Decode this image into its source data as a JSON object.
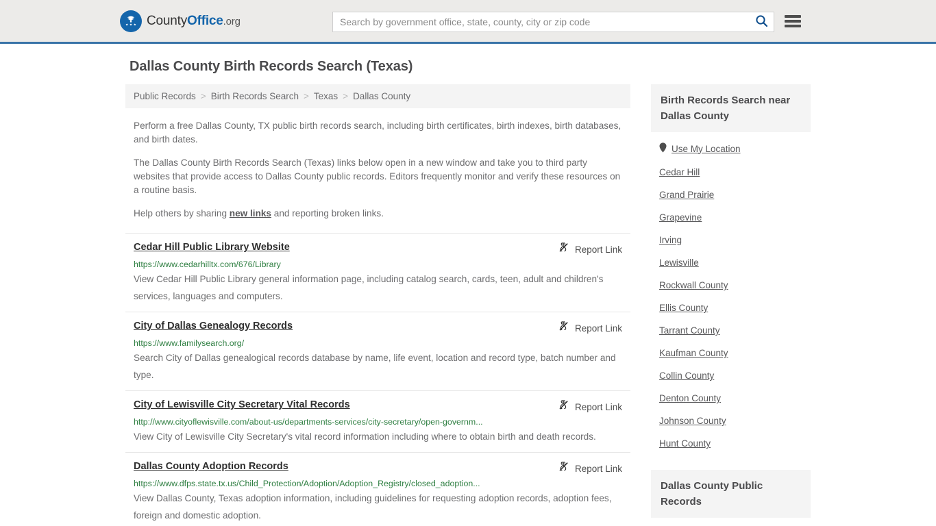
{
  "header": {
    "logo": {
      "icon": "eagle-seal-icon",
      "text_part1": "County",
      "text_part2": "Office",
      "text_part3": ".org"
    },
    "search": {
      "placeholder": "Search by government office, state, county, city or zip code",
      "value": "",
      "search_icon": "search-icon"
    },
    "menu_icon": "hamburger-menu-icon",
    "accent_color": "#3a74a8",
    "background_color": "#ecebe9"
  },
  "main": {
    "title": "Dallas County Birth Records Search (Texas)",
    "breadcrumb": [
      "Public Records",
      "Birth Records Search",
      "Texas",
      "Dallas County"
    ],
    "breadcrumb_separator": ">",
    "intro": {
      "p1": "Perform a free Dallas County, TX public birth records search, including birth certificates, birth indexes, birth databases, and birth dates.",
      "p2": "The Dallas County Birth Records Search (Texas) links below open in a new window and take you to third party websites that provide access to Dallas County public records. Editors frequently monitor and verify these resources on a routine basis.",
      "p3_before": "Help others by sharing ",
      "p3_link": "new links",
      "p3_after": " and reporting broken links."
    },
    "report_link_label": "Report Link",
    "report_link_icon": "broken-link-icon",
    "results": [
      {
        "title": "Cedar Hill Public Library Website",
        "url": "https://www.cedarhilltx.com/676/Library",
        "description": "View Cedar Hill Public Library general information page, including catalog search, cards, teen, adult and children's services, languages and computers."
      },
      {
        "title": "City of Dallas Genealogy Records",
        "url": "https://www.familysearch.org/",
        "description": "Search City of Dallas genealogical records database by name, life event, location and record type, batch number and type."
      },
      {
        "title": "City of Lewisville City Secretary Vital Records",
        "url": "http://www.cityoflewisville.com/about-us/departments-services/city-secretary/open-governm...",
        "description": "View City of Lewisville City Secretary's vital record information including where to obtain birth and death records."
      },
      {
        "title": "Dallas County Adoption Records",
        "url": "https://www.dfps.state.tx.us/Child_Protection/Adoption/Adoption_Registry/closed_adoption...",
        "description": "View Dallas County, Texas adoption information, including guidelines for requesting adoption records, adoption fees, foreign and domestic adoption."
      }
    ]
  },
  "sidebar": {
    "nearby_heading": "Birth Records Search near Dallas County",
    "use_my_location": {
      "label": "Use My Location",
      "icon": "map-pin-icon"
    },
    "nearby_links": [
      "Cedar Hill",
      "Grand Prairie",
      "Grapevine",
      "Irving",
      "Lewisville",
      "Rockwall County",
      "Ellis County",
      "Tarrant County",
      "Kaufman County",
      "Collin County",
      "Denton County",
      "Johnson County",
      "Hunt County"
    ],
    "public_records_heading": "Dallas County Public Records"
  }
}
